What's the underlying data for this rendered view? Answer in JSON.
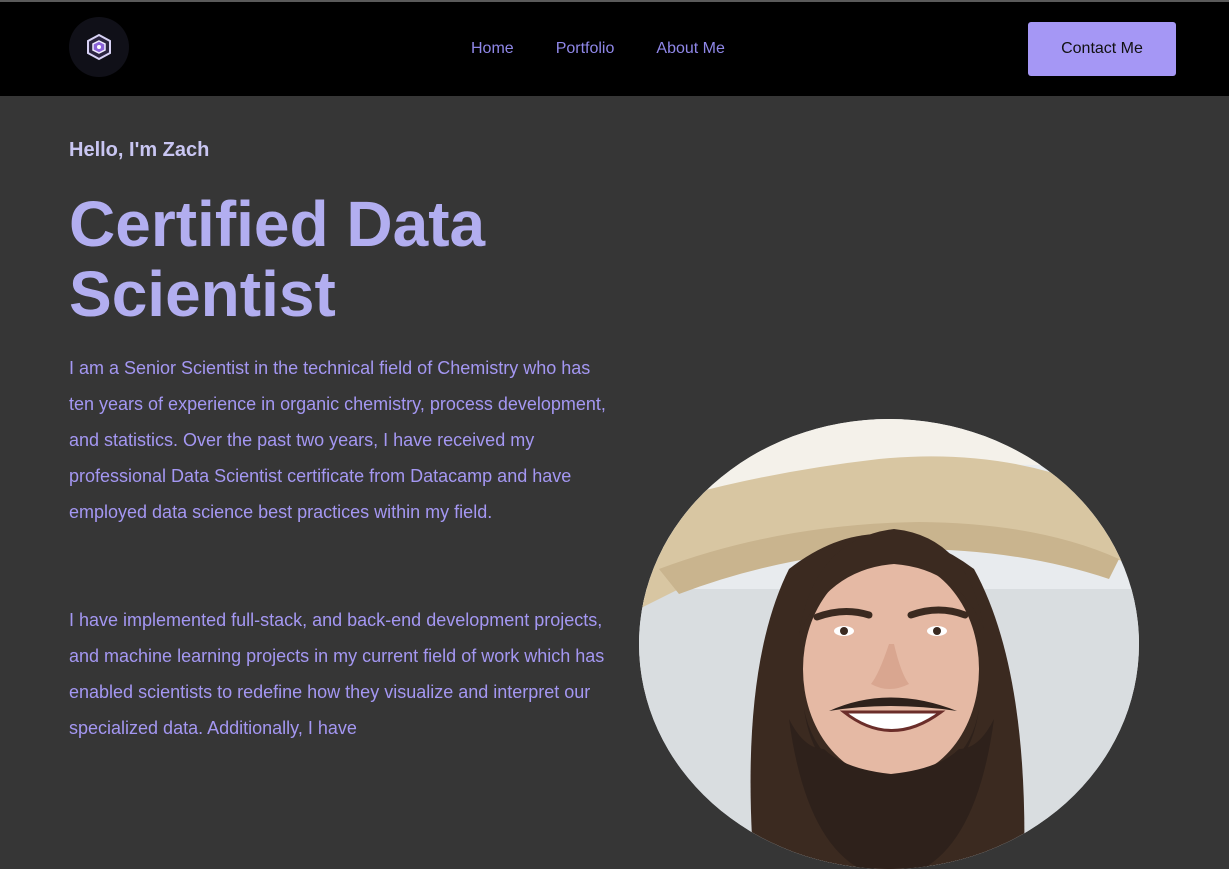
{
  "nav": {
    "logo_icon": "cube-network-icon",
    "links": [
      "Home",
      "Portfolio",
      "About Me"
    ],
    "contact_label": "Contact Me"
  },
  "hero": {
    "greeting": "Hello, I'm Zach",
    "title": "Certified Data Scientist",
    "paragraph1": "I am a Senior Scientist in the technical field of Chemistry who has ten years of experience in organic chemistry, process development, and statistics. Over the past two years, I have received my professional Data Scientist certificate from Datacamp and have employed data science best practices within my field.",
    "paragraph2": "I have implemented full-stack, and back-end development projects, and machine learning projects in my current field of work which has enabled scientists to redefine how they visualize and interpret our specialized data. Additionally, I have"
  },
  "colors": {
    "accent": "#a597f5",
    "title": "#b2aef0",
    "text": "#a497f2",
    "background": "#363636",
    "navbar": "#000000"
  }
}
